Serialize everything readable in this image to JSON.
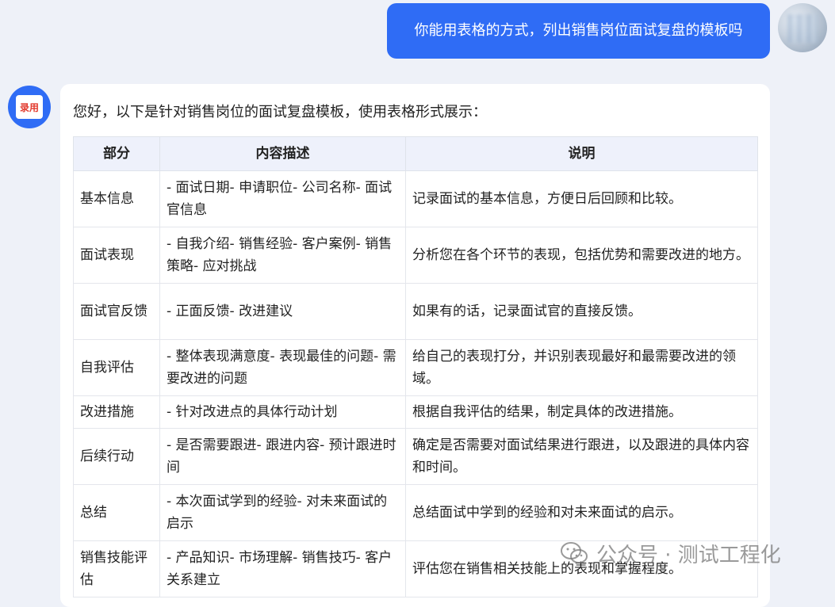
{
  "conversation": {
    "user_message": "你能用表格的方式，列出销售岗位面试复盘的模板吗",
    "bot_badge": "录用",
    "bot_intro": "您好，以下是针对销售岗位的面试复盘模板，使用表格形式展示：",
    "table": {
      "headers": [
        "部分",
        "内容描述",
        "说明"
      ],
      "rows": [
        {
          "part": "基本信息",
          "content": "- 面试日期- 申请职位- 公司名称- 面试官信息",
          "note": "记录面试的基本信息，方便日后回顾和比较。"
        },
        {
          "part": "面试表现",
          "content": "- 自我介绍- 销售经验- 客户案例- 销售策略- 应对挑战",
          "note": "分析您在各个环节的表现，包括优势和需要改进的地方。"
        },
        {
          "part": "面试官反馈",
          "content": "- 正面反馈- 改进建议",
          "note": "如果有的话，记录面试官的直接反馈。"
        },
        {
          "part": "自我评估",
          "content": "- 整体表现满意度- 表现最佳的问题- 需要改进的问题",
          "note": "给自己的表现打分，并识别表现最好和最需要改进的领域。"
        },
        {
          "part": "改进措施",
          "content": "- 针对改进点的具体行动计划",
          "note": "根据自我评估的结果，制定具体的改进措施。"
        },
        {
          "part": "后续行动",
          "content": "- 是否需要跟进- 跟进内容- 预计跟进时间",
          "note": "确定是否需要对面试结果进行跟进，以及跟进的具体内容和时间。"
        },
        {
          "part": "总结",
          "content": "- 本次面试学到的经验- 对未来面试的启示",
          "note": "总结面试中学到的经验和对未来面试的启示。"
        },
        {
          "part": "销售技能评估",
          "content": "- 产品知识- 市场理解- 销售技巧- 客户关系建立",
          "note": "评估您在销售相关技能上的表现和掌握程度。"
        }
      ]
    }
  },
  "watermark": {
    "text": "公众号 · 测试工程化",
    "icon": "wechat-icon"
  },
  "colors": {
    "accent": "#2f6cf5",
    "table_header_bg": "#eef1fb",
    "page_bg": "#eef1f8"
  }
}
